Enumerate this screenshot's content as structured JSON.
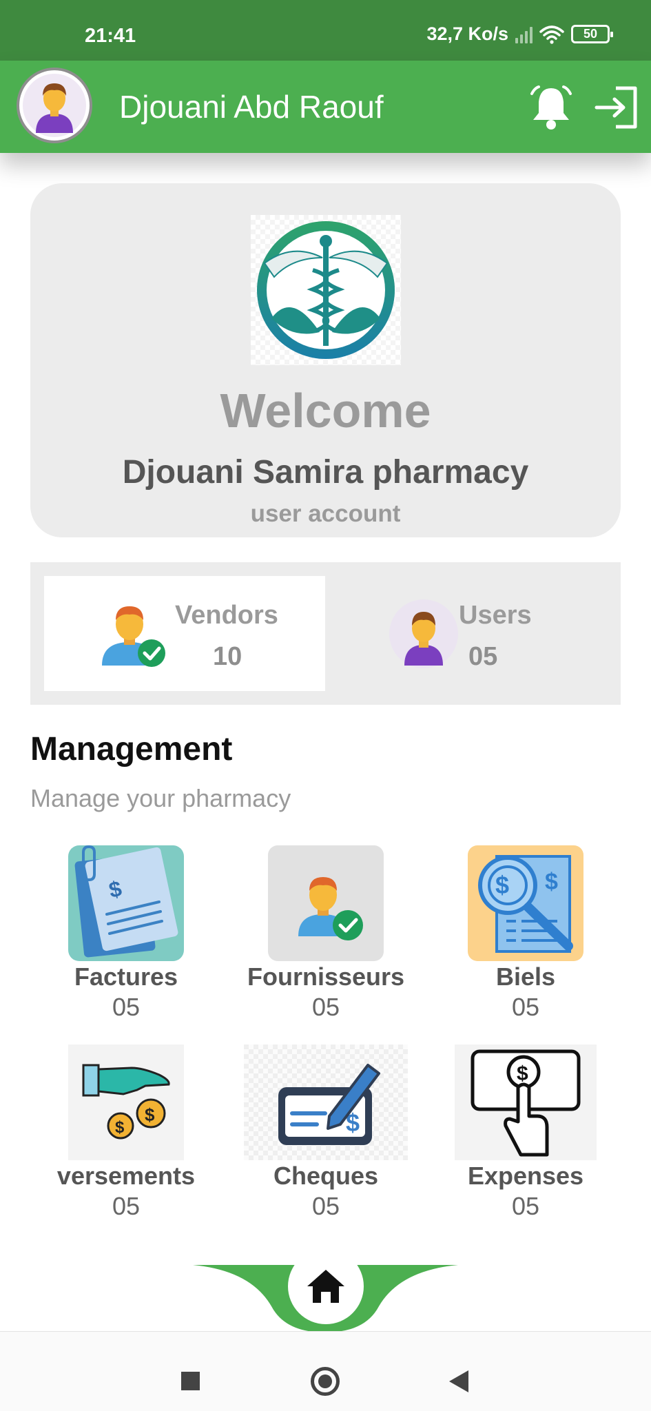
{
  "status_bar": {
    "time": "21:41",
    "network_speed": "32,7 Ko/s",
    "battery": "50"
  },
  "header": {
    "user_name": "Djouani Abd Raouf",
    "bell_icon": "notification-bell-icon",
    "logout_icon": "logout-icon",
    "color": "#4caf50"
  },
  "welcome": {
    "title": "Welcome",
    "pharmacy_name": "Djouani Samira pharmacy",
    "account_type": "user account"
  },
  "stats": [
    {
      "label": "Vendors",
      "value": "10",
      "icon": "vendor-check-icon"
    },
    {
      "label": "Users",
      "value": "05",
      "icon": "user-avatar-icon"
    }
  ],
  "management": {
    "title": "Management",
    "subtitle": "Manage your pharmacy",
    "tiles": [
      {
        "label": "Factures",
        "count": "05",
        "icon": "invoice-document-icon"
      },
      {
        "label": "Fournisseurs",
        "count": "05",
        "icon": "supplier-user-icon"
      },
      {
        "label": "Biels",
        "count": "05",
        "icon": "bill-search-icon"
      },
      {
        "label": "versements",
        "count": "05",
        "icon": "payment-hand-coins-icon"
      },
      {
        "label": "Cheques",
        "count": "05",
        "icon": "cheque-pen-icon"
      },
      {
        "label": "Expenses",
        "count": "05",
        "icon": "expense-hand-icon"
      }
    ]
  },
  "bottom_nav": {
    "home_icon": "home-icon"
  }
}
